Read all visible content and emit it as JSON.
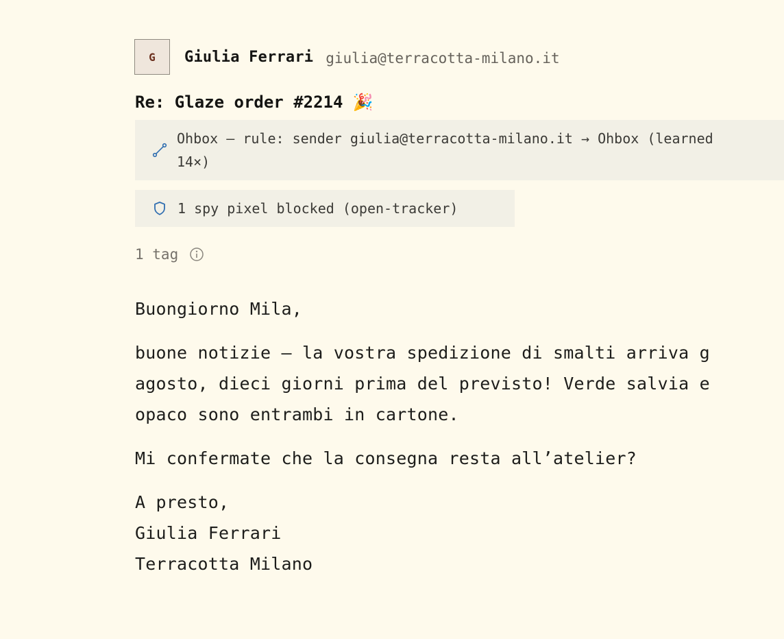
{
  "sender": {
    "avatar_initial": "G",
    "name": "Giulia Ferrari",
    "email": "giulia@terracotta-milano.it"
  },
  "subject": {
    "text": "Re: Glaze order #2214",
    "emoji": "🎉"
  },
  "rule_notice": {
    "icon": "route-icon",
    "line1": "Ohbox — rule: sender giulia@terracotta-milano.it → Ohbox (learned",
    "line2": "14×)"
  },
  "tracker_notice": {
    "icon": "shield-icon",
    "text": "1 spy pixel blocked (open-tracker)"
  },
  "tags": {
    "label": "1 tag",
    "icon": "info-icon"
  },
  "body": {
    "greeting": "Buongiorno Mila,",
    "para1_line1": "buone notizie — la vostra spedizione di smalti arriva g",
    "para1_line2": "agosto, dieci giorni prima del previsto! Verde salvia e",
    "para1_line3": "opaco sono entrambi in cartone.",
    "para2": "Mi confermate che la consegna resta all’atelier?",
    "signoff": "A presto,",
    "sig_name": "Giulia Ferrari",
    "sig_company": "Terracotta Milano"
  },
  "colors": {
    "background": "#fefaec",
    "notice_bg": "#f2f0e6",
    "accent_blue": "#2f6db0",
    "avatar_text": "#6b2f1d"
  }
}
